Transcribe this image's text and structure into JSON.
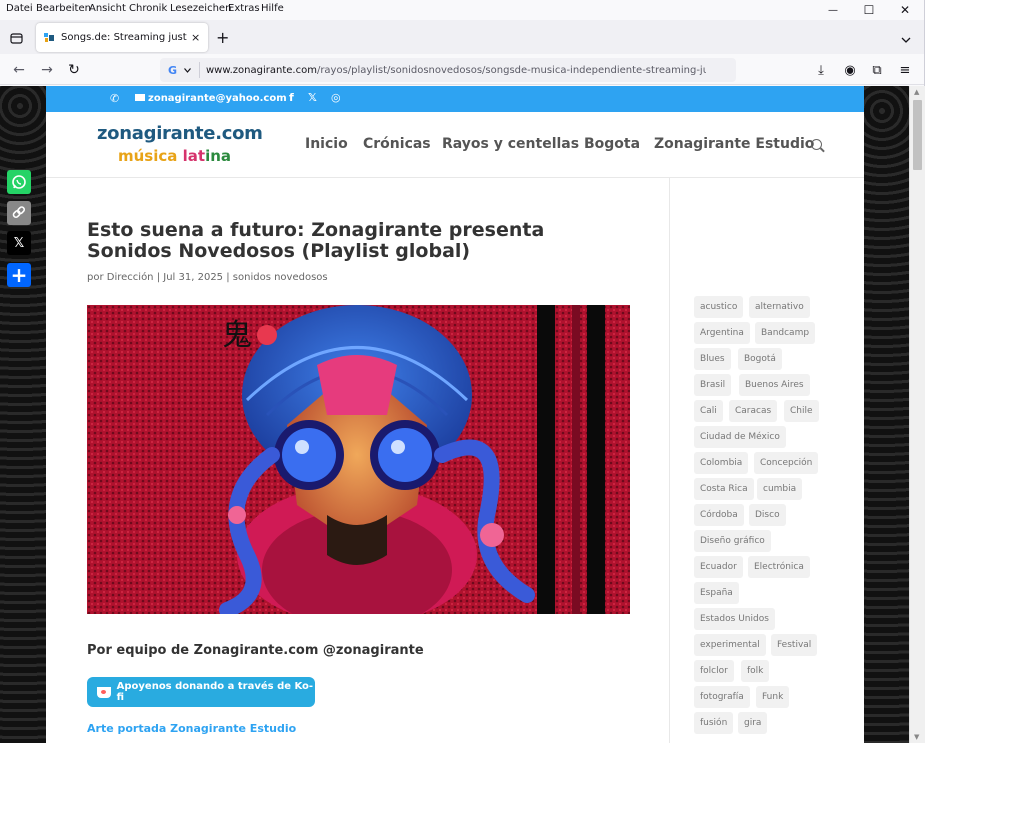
{
  "menubar": {
    "items": [
      "Datei",
      "Bearbeiten",
      "Ansicht",
      "Chronik",
      "Lesezeichen",
      "Extras",
      "Hilfe"
    ]
  },
  "tab": {
    "title": "Songs.de: Streaming justo para",
    "close": "×"
  },
  "newtab": "+",
  "urlbar": {
    "host": "www.zonagirante.com",
    "path": "/rayos/playlist/sonidosnovedosos/songsde-musica-independiente-streaming-justo/"
  },
  "topbar": {
    "email": "zonagirante@yahoo.com"
  },
  "logo": {
    "line1": "zonagirante.com",
    "line2_a": "música",
    "line2_b": " lat",
    "line2_c": "ina"
  },
  "nav": [
    "Inicio",
    "Crónicas",
    "Rayos y centellas",
    "Bogota",
    "Zonagirante Estudio"
  ],
  "post": {
    "title": "Esto suena a futuro: Zonagirante presenta Sonidos Novedosos (Playlist global)",
    "meta_prefix": "por ",
    "author": "Dirección",
    "sep1": " | ",
    "date": "Jul 31, 2025",
    "sep2": " | ",
    "category": "sonidos novedosos",
    "byline": "Por equipo de Zonagirante.com @zonagirante",
    "kofi_label": "Apoyenos donando a través de Ko-fi",
    "art_link": "Arte portada Zonagirante Estudio",
    "hero_glyph": "鬼"
  },
  "tags": [
    "acustico",
    "alternativo",
    "Argentina",
    "Bandcamp",
    "Blues",
    "Bogotá",
    "Brasil",
    "Buenos Aires",
    "Cali",
    "Caracas",
    "Chile",
    "Ciudad de México",
    "Colombia",
    "Concepción",
    "Costa Rica",
    "cumbia",
    "Córdoba",
    "Disco",
    "Diseño gráfico",
    "Ecuador",
    "Electrónica",
    "España",
    "Estados Unidos",
    "experimental",
    "Festival",
    "folclor",
    "folk",
    "fotografía",
    "Funk",
    "fusión",
    "gira"
  ],
  "icons": {
    "back": "←",
    "forward": "→",
    "reload": "↻",
    "down_chev": "⌄",
    "minimize": "—",
    "maximize": "☐",
    "close": "✕",
    "download": "⤓",
    "account": "◉",
    "extensions": "⧉",
    "menu": "≡",
    "phone": "✆",
    "facebook": "f",
    "x": "𝕏",
    "instagram": "◎",
    "share_x": "𝕏",
    "share_plus": "+"
  }
}
